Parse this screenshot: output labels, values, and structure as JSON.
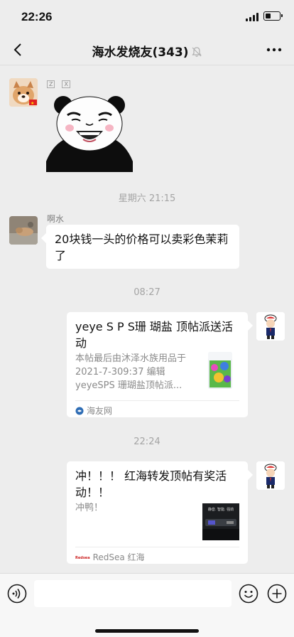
{
  "status_bar": {
    "time": "22:26"
  },
  "header": {
    "title": "海水发烧友(343)"
  },
  "messages": [
    {
      "type": "sticker",
      "sticker_tags": [
        "Z",
        "X"
      ]
    },
    {
      "type": "time",
      "text": "星期六 21:15"
    },
    {
      "type": "text",
      "sender": "啊水",
      "text": "20块钱一头的价格可以卖彩色茉莉了"
    },
    {
      "type": "time",
      "text": "08:27"
    },
    {
      "type": "link",
      "title": "yeye S P S珊 瑚盐 顶帖派送活动",
      "desc": "本帖最后由沐泽水族用品于 2021-7-309:37 编辑 yeyeSPS 珊瑚盐顶帖派...",
      "source": "海友网"
    },
    {
      "type": "time",
      "text": "22:24"
    },
    {
      "type": "link",
      "title": "冲！！！ 红海转发顶帖有奖活动！！",
      "desc": "冲鸭！",
      "thumb_text": "静音. 智能. 强劲",
      "source_logo": "Redsea",
      "source": "RedSea 红海"
    }
  ],
  "input_bar": {
    "placeholder": ""
  }
}
